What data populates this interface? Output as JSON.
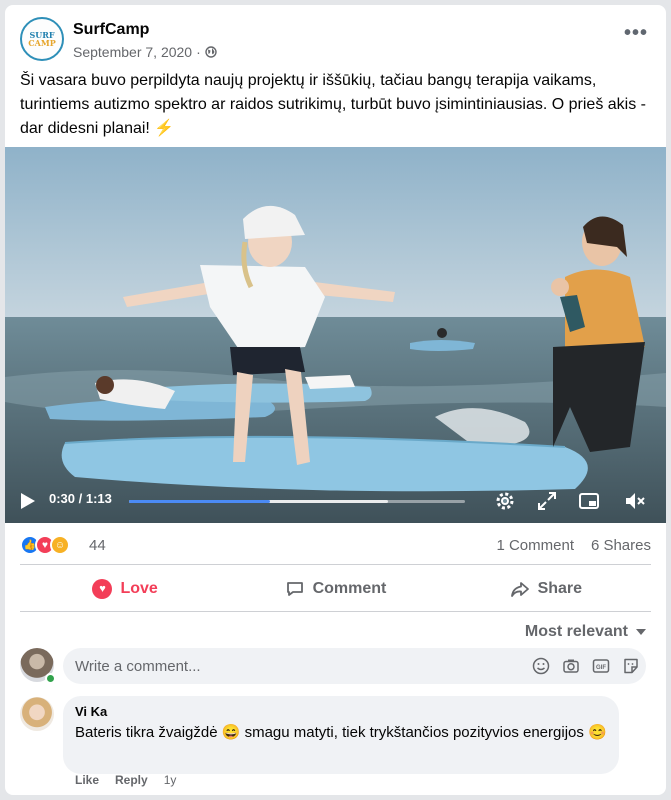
{
  "post": {
    "page_name": "SurfCamp",
    "logo_text_top": "SURF",
    "logo_text_bottom": "CAMP",
    "date": "September 7, 2020",
    "separator": "·",
    "text": "Ši vasara buvo perpildyta naujų projektų ir iššūkių, tačiau bangų terapija vaikams, turintiems autizmo spektro ar raidos sutrikimų, turbūt buvo įsimintiniausias. O prieš akis - dar didesni planai! ⚡",
    "more_label": "•••"
  },
  "video": {
    "time_display": "0:30 / 1:13",
    "progress_fraction": 0.42,
    "buffered_fraction": 0.77
  },
  "stats": {
    "reaction_count": "44",
    "comments": "1 Comment",
    "shares": "6 Shares"
  },
  "actions": {
    "love": "Love",
    "comment": "Comment",
    "share": "Share"
  },
  "comments_section": {
    "sort_label": "Most relevant",
    "input_placeholder": "Write a comment...",
    "items": [
      {
        "author": "Vi Ka",
        "text": "Bateris tikra žvaigždė 😄 smagu matyti, tiek trykštančios pozityvios energijos 😊",
        "like_label": "Like",
        "reply_label": "Reply",
        "age": "1y"
      }
    ]
  },
  "colors": {
    "brand_blue": "#1877f2",
    "love_red": "#f33e58",
    "progress_blue": "#4b8bf5"
  }
}
